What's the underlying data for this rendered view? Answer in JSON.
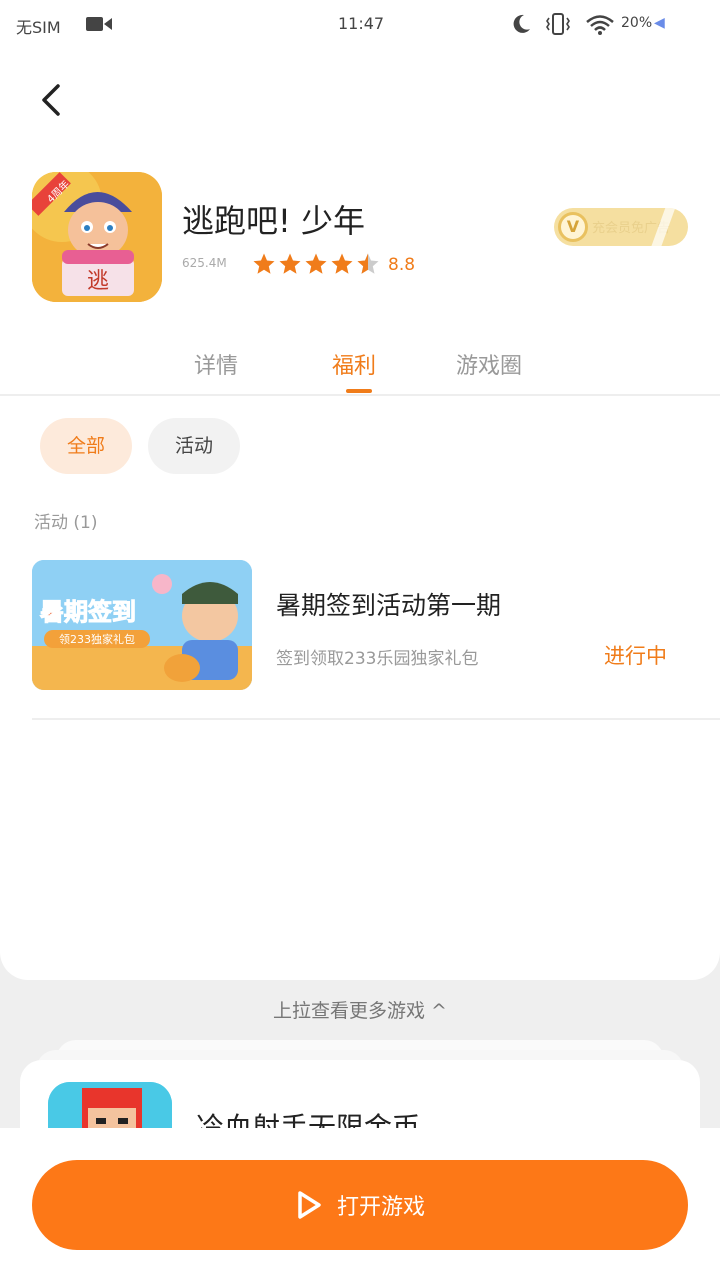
{
  "status_bar": {
    "carrier": "无SIM",
    "time": "11:47",
    "battery": "20%",
    "icons": [
      "video-icon",
      "moon-icon",
      "vibrate-icon",
      "wifi-icon",
      "charging-icon"
    ]
  },
  "header": {
    "back_icon": "chevron-left-icon"
  },
  "app": {
    "name": "逃跑吧! 少年",
    "size": "625.4M",
    "rating": "8.8",
    "stars": 4.5,
    "vip_badge": "V",
    "vip_text": "充会员免广告"
  },
  "tabs": [
    {
      "label": "详情",
      "active": false
    },
    {
      "label": "福利",
      "active": true
    },
    {
      "label": "游戏圈",
      "active": false
    }
  ],
  "filters": [
    {
      "label": "全部",
      "selected": true
    },
    {
      "label": "活动",
      "selected": false
    }
  ],
  "section": {
    "label": "活动 (1)"
  },
  "activity": {
    "image_title": "暑期签到",
    "image_subtitle": "领233独家礼包",
    "title": "暑期签到活动第一期",
    "description": "签到领取233乐园独家礼包",
    "status": "进行中"
  },
  "more": {
    "label": "上拉查看更多游戏 ^"
  },
  "next_game": {
    "title": "冷血射手无限金币"
  },
  "bottom": {
    "open_button": "打开游戏"
  },
  "colors": {
    "accent": "#f07c1a",
    "button": "#fd7817",
    "vip": "#f5dfa0"
  }
}
